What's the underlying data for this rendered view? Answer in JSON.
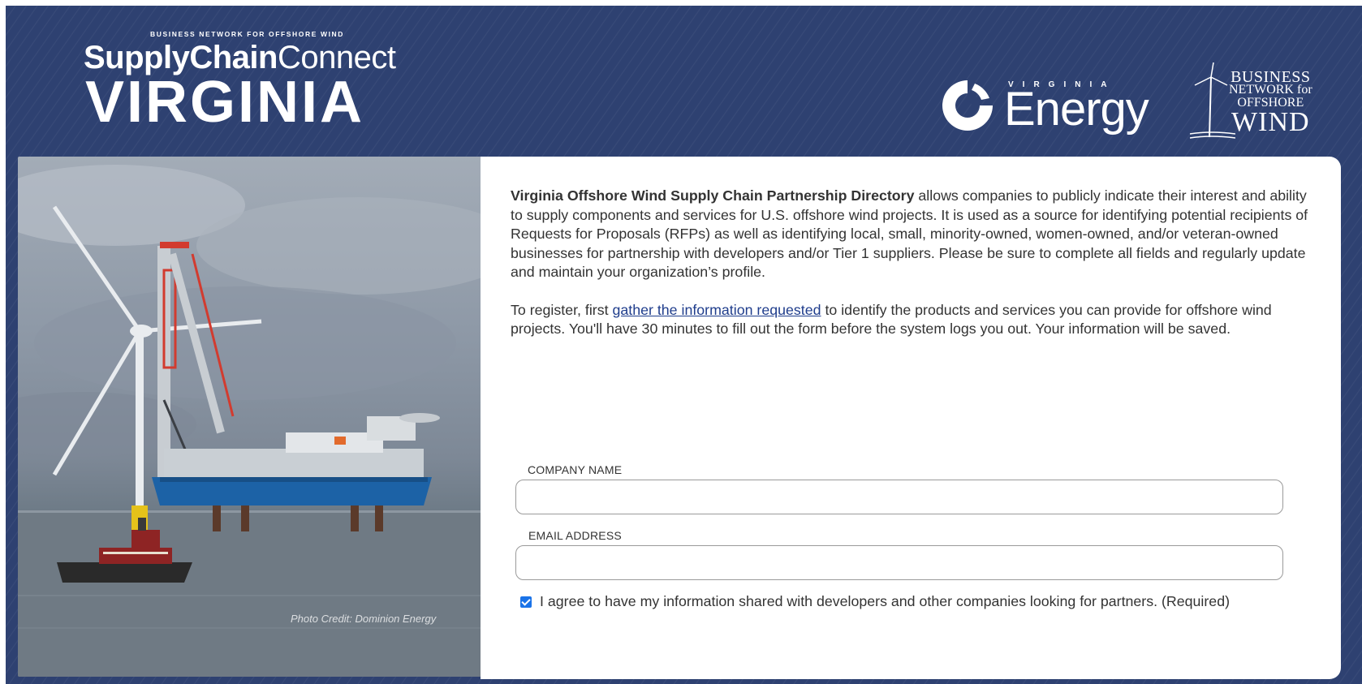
{
  "header": {
    "brand_kicker": "BUSINESS NETWORK FOR OFFSHORE WIND",
    "brand_bold": "SupplyChain",
    "brand_light": "Connect",
    "brand_state": "VIRGINIA",
    "energy_logo": {
      "small": "VIRGINIA",
      "word": "Energy"
    },
    "bnow_logo": {
      "line1": "BUSINESS",
      "line2": "NETWORK for",
      "line3": "OFFSHORE",
      "line4": "WIND"
    }
  },
  "photo": {
    "credit": "Photo Credit: Dominion Energy"
  },
  "intro": {
    "title": "Virginia Offshore Wind Supply Chain Partnership Directory",
    "p1_rest": " allows companies to publicly indicate their interest and ability to supply components and services for U.S. offshore wind projects. It is used as a source for identifying potential recipients of Requests for Proposals (RFPs) as well as identifying local, small, minority-owned, women-owned, and/or veteran-owned businesses for partnership with developers and/or Tier 1 suppliers. Please be sure to complete all fields and regularly update and maintain your organization’s profile.",
    "p2_before": "To register, first ",
    "p2_link": "gather the information requested",
    "p2_after": " to identify the products and services you can provide for offshore wind projects. You'll have 30 minutes to fill out the form before the system logs you out. Your information will be saved."
  },
  "form": {
    "company_label": "COMPANY NAME",
    "company_value": "",
    "email_label": "EMAIL ADDRESS",
    "email_value": "",
    "consent_checked": true,
    "consent_text": "I agree to have my information shared with developers and other companies looking for partners. (Required)"
  },
  "colors": {
    "background": "#2e4171",
    "card": "#ffffff",
    "link": "#1f3d8c",
    "checkbox": "#1a73e8"
  }
}
